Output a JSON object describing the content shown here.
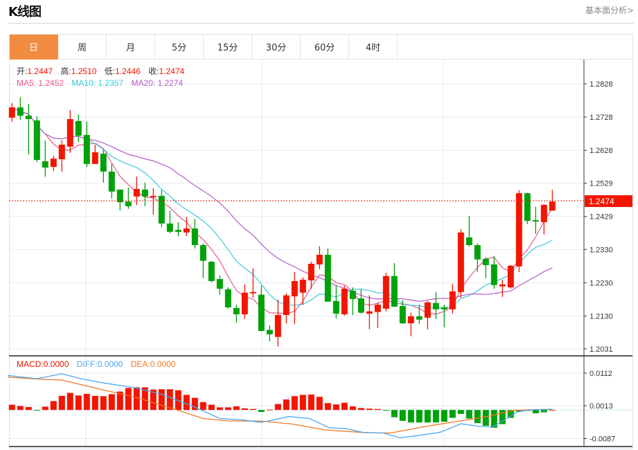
{
  "header": {
    "title": "K线图",
    "fundamental_link": "基本面分析>"
  },
  "tabs": [
    {
      "label": "日",
      "active": true
    },
    {
      "label": "周"
    },
    {
      "label": "月"
    },
    {
      "label": "5分"
    },
    {
      "label": "15分"
    },
    {
      "label": "30分"
    },
    {
      "label": "60分"
    },
    {
      "label": "4时"
    }
  ],
  "legend": {
    "open_label": "开:",
    "open": "1.2447",
    "high_label": "高:",
    "high": "1.2510",
    "low_label": "低:",
    "low": "1.2446",
    "close_label": "收:",
    "close": "1.2474",
    "ma5": "MA5: 1.2452",
    "ma10": "MA10: 1.2357",
    "ma20": "MA20: 1.2274"
  },
  "macd_legend": {
    "macd": "MACD:0.0000",
    "diff": "DIFF:0.0000",
    "dea": "DEA:0.0000"
  },
  "colors": {
    "up": "#f21600",
    "down": "#00a10a",
    "ma5": "#e8578a",
    "ma10": "#3cc8dc",
    "ma20": "#b25ac8",
    "diff": "#4aa8f0",
    "dea": "#f07820",
    "accent": "#f28c40"
  },
  "chart_data": {
    "type": "candlestick",
    "current_price": 1.2474,
    "current_price_label": "1.2474",
    "price_ticks": [
      "1.2828",
      "1.2728",
      "1.2628",
      "1.2529",
      "1.2429",
      "1.2330",
      "1.2230",
      "1.2130",
      "1.2031"
    ],
    "price_range": [
      1.2031,
      1.2828
    ],
    "ohlc": [
      [
        1.2726,
        1.277,
        1.2714,
        1.2757
      ],
      [
        1.2757,
        1.2788,
        1.272,
        1.2732
      ],
      [
        1.2732,
        1.2768,
        1.2616,
        1.2722
      ],
      [
        1.2718,
        1.273,
        1.2593,
        1.2599
      ],
      [
        1.2595,
        1.2657,
        1.2549,
        1.2576
      ],
      [
        1.2578,
        1.2612,
        1.2566,
        1.2603
      ],
      [
        1.2601,
        1.2657,
        1.2564,
        1.2645
      ],
      [
        1.2639,
        1.2749,
        1.262,
        1.2722
      ],
      [
        1.2716,
        1.2736,
        1.2653,
        1.2672
      ],
      [
        1.2674,
        1.2714,
        1.2578,
        1.2587
      ],
      [
        1.2587,
        1.2645,
        1.2587,
        1.2622
      ],
      [
        1.2618,
        1.263,
        1.2531,
        1.2564
      ],
      [
        1.2564,
        1.2587,
        1.2483,
        1.2504
      ],
      [
        1.251,
        1.251,
        1.2447,
        1.2472
      ],
      [
        1.2474,
        1.2516,
        1.2452,
        1.246
      ],
      [
        1.2489,
        1.2549,
        1.2464,
        1.2512
      ],
      [
        1.251,
        1.2531,
        1.246,
        1.2489
      ],
      [
        1.2487,
        1.2514,
        1.2435,
        1.2491
      ],
      [
        1.2491,
        1.2508,
        1.2397,
        1.2408
      ],
      [
        1.2408,
        1.2447,
        1.2379,
        1.2383
      ],
      [
        1.2389,
        1.2412,
        1.237,
        1.2383
      ],
      [
        1.2381,
        1.2427,
        1.237,
        1.2393
      ],
      [
        1.2393,
        1.2422,
        1.2333,
        1.2343
      ],
      [
        1.2343,
        1.2348,
        1.2244,
        1.2296
      ],
      [
        1.2293,
        1.2296,
        1.2231,
        1.2235
      ],
      [
        1.2241,
        1.2252,
        1.2194,
        1.2212
      ],
      [
        1.221,
        1.2216,
        1.2152,
        1.2156
      ],
      [
        1.2154,
        1.2164,
        1.211,
        1.2135
      ],
      [
        1.2135,
        1.2225,
        1.2121,
        1.22
      ],
      [
        1.2198,
        1.2273,
        1.2185,
        1.2202
      ],
      [
        1.2194,
        1.2221,
        1.2083,
        1.2085
      ],
      [
        1.2088,
        1.2102,
        1.2054,
        1.2075
      ],
      [
        1.2067,
        1.2179,
        1.2038,
        1.2133
      ],
      [
        1.2133,
        1.2198,
        1.2108,
        1.2192
      ],
      [
        1.2189,
        1.2262,
        1.2106,
        1.2235
      ],
      [
        1.22,
        1.2246,
        1.2164,
        1.2239
      ],
      [
        1.2237,
        1.2293,
        1.2212,
        1.2287
      ],
      [
        1.2285,
        1.2339,
        1.2271,
        1.2314
      ],
      [
        1.2314,
        1.2333,
        1.2173,
        1.2173
      ],
      [
        1.2175,
        1.2223,
        1.2123,
        1.2137
      ],
      [
        1.2135,
        1.2221,
        1.2131,
        1.2212
      ],
      [
        1.2206,
        1.2216,
        1.2133,
        1.2181
      ],
      [
        1.2183,
        1.221,
        1.2137,
        1.214
      ],
      [
        1.2137,
        1.2192,
        1.209,
        1.2144
      ],
      [
        1.2142,
        1.2171,
        1.2094,
        1.2164
      ],
      [
        1.2152,
        1.226,
        1.2144,
        1.225
      ],
      [
        1.225,
        1.2289,
        1.2158,
        1.2158
      ],
      [
        1.216,
        1.2177,
        1.2106,
        1.2108
      ],
      [
        1.2108,
        1.214,
        1.2069,
        1.2129
      ],
      [
        1.2129,
        1.2164,
        1.2106,
        1.2119
      ],
      [
        1.2125,
        1.2175,
        1.209,
        1.2171
      ],
      [
        1.2169,
        1.2202,
        1.2121,
        1.215
      ],
      [
        1.2156,
        1.2164,
        1.2096,
        1.215
      ],
      [
        1.215,
        1.2227,
        1.2137,
        1.2204
      ],
      [
        1.2202,
        1.2391,
        1.2185,
        1.2381
      ],
      [
        1.2366,
        1.2431,
        1.2339,
        1.2343
      ],
      [
        1.2343,
        1.2348,
        1.2262,
        1.23
      ],
      [
        1.2302,
        1.2306,
        1.2244,
        1.2283
      ],
      [
        1.2285,
        1.231,
        1.2212,
        1.2223
      ],
      [
        1.2219,
        1.2239,
        1.2187,
        1.2225
      ],
      [
        1.2216,
        1.2283,
        1.2212,
        1.2281
      ],
      [
        1.2279,
        1.2508,
        1.2262,
        1.2499
      ],
      [
        1.2499,
        1.2501,
        1.2406,
        1.2416
      ],
      [
        1.2418,
        1.2458,
        1.2377,
        1.2414
      ],
      [
        1.2412,
        1.2466,
        1.2375,
        1.2464
      ],
      [
        1.2447,
        1.251,
        1.2446,
        1.2474
      ]
    ],
    "macd": {
      "ticks": [
        "0.0112",
        "0.0013",
        "-0.0087"
      ],
      "range": [
        -0.0087,
        0.0112
      ],
      "histogram": [
        0.0016,
        0.0012,
        0.0009,
        -0.0001,
        0.001,
        0.0027,
        0.0043,
        0.0052,
        0.0044,
        0.0049,
        0.0043,
        0.0042,
        0.0048,
        0.0056,
        0.0067,
        0.0069,
        0.0069,
        0.0062,
        0.0063,
        0.0063,
        0.006,
        0.0046,
        0.0037,
        0.0024,
        0.0016,
        0.0008,
        0.0008,
        0.0011,
        0.0005,
        0.0003,
        -0.0006,
        0.0001,
        0.0018,
        0.0032,
        0.0042,
        0.0046,
        0.0047,
        0.004,
        0.0021,
        0.0017,
        0.0022,
        0.0011,
        0.0006,
        0.0004,
        0.0003,
        -0.0002,
        -0.0022,
        -0.0033,
        -0.0038,
        -0.0038,
        -0.0038,
        -0.0038,
        -0.0036,
        -0.0024,
        -0.0012,
        -0.0026,
        -0.004,
        -0.0048,
        -0.0054,
        -0.0043,
        -0.0024,
        -0.0005,
        -0.0003,
        -0.001,
        -0.0007,
        0.0
      ],
      "diff": [
        [
          -0.5,
          0.0105
        ],
        [
          3,
          0.0095
        ],
        [
          6,
          0.011
        ],
        [
          8.3,
          0.0095
        ],
        [
          11,
          0.0082
        ],
        [
          14.7,
          0.0068
        ],
        [
          18.1,
          0.0047
        ],
        [
          21.6,
          0.0013
        ],
        [
          25,
          -0.0026
        ],
        [
          28,
          -0.0031
        ],
        [
          30,
          -0.0038
        ],
        [
          33.3,
          -0.002
        ],
        [
          35.8,
          -0.0026
        ],
        [
          38.2,
          -0.0054
        ],
        [
          40.2,
          -0.0057
        ],
        [
          42.2,
          -0.0068
        ],
        [
          44.6,
          -0.007
        ],
        [
          46.6,
          -0.0084
        ],
        [
          48.5,
          -0.0079
        ],
        [
          51.5,
          -0.0068
        ],
        [
          54,
          -0.0042
        ],
        [
          56,
          -0.0049
        ],
        [
          57.8,
          -0.0052
        ],
        [
          59.3,
          -0.0029
        ],
        [
          60.8,
          -0.0006
        ],
        [
          62.3,
          0.0
        ],
        [
          65,
          0.0002
        ]
      ],
      "dea": [
        [
          -0.5,
          0.01
        ],
        [
          3,
          0.0094
        ],
        [
          6,
          0.0091
        ],
        [
          11,
          0.0061
        ],
        [
          14.7,
          0.004
        ],
        [
          19.6,
          0.0002
        ],
        [
          23,
          -0.0026
        ],
        [
          26,
          -0.0033
        ],
        [
          30,
          -0.0034
        ],
        [
          33.8,
          -0.0043
        ],
        [
          37.7,
          -0.0061
        ],
        [
          42.6,
          -0.0069
        ],
        [
          45.6,
          -0.007
        ],
        [
          50,
          -0.0049
        ],
        [
          54,
          -0.0033
        ],
        [
          57.4,
          -0.0019
        ],
        [
          60.3,
          -0.0001
        ],
        [
          64.7,
          0.0002
        ]
      ]
    }
  }
}
